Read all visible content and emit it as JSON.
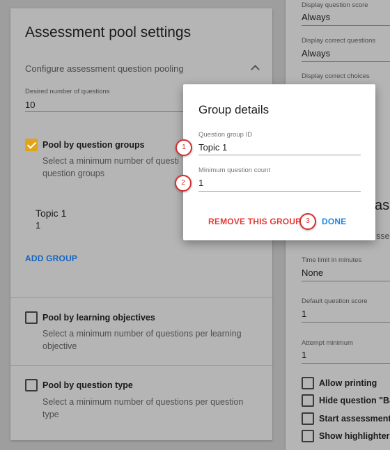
{
  "pool": {
    "title": "Assessment pool settings",
    "subtitle": "Configure assessment question pooling",
    "desired_label": "Desired number of questions",
    "desired_value": "10",
    "by_groups": {
      "label": "Pool by question groups",
      "help_line1": "Select a minimum number of questi",
      "help_line2": "question groups",
      "checked": true
    },
    "group_item": {
      "name": "Topic 1",
      "count": "1"
    },
    "add_group": "ADD GROUP",
    "by_objectives": {
      "label": "Pool by learning objectives",
      "help_line1": "Select a minimum number of questions per learning",
      "help_line2": "objective",
      "checked": false
    },
    "by_type": {
      "label": "Pool by question type",
      "help_line1": "Select a minimum number of questions per question",
      "help_line2": "type",
      "checked": false
    }
  },
  "right": {
    "display_score_label": "Display question score",
    "display_score_value": "Always",
    "display_correct_q_label": "Display correct questions",
    "display_correct_q_value": "Always",
    "display_correct_choices_label": "Display correct choices",
    "heading_fragment": "ass",
    "heading_sub_fragment": "sses",
    "time_limit_label": "Time limit in minutes",
    "time_limit_value": "None",
    "default_score_label": "Default question score",
    "default_score_value": "1",
    "attempt_min_label": "Attempt minimum",
    "attempt_min_value": "1",
    "options": [
      "Allow printing",
      "Hide question \"Ba",
      "Start assessment",
      "Show highlighter"
    ]
  },
  "dialog": {
    "title": "Group details",
    "group_id_label": "Question group ID",
    "group_id_value": "Topic 1",
    "min_count_label": "Minimum question count",
    "min_count_value": "1",
    "remove_label": "REMOVE THIS GROUP",
    "done_label": "DONE"
  },
  "markers": [
    "1",
    "2",
    "3"
  ],
  "colors": {
    "accent_check": "#e0a41b",
    "link_blue": "#1565c0",
    "remove_red": "#e53935",
    "done_blue": "#1e88e5",
    "marker_red": "#d32f2f"
  }
}
